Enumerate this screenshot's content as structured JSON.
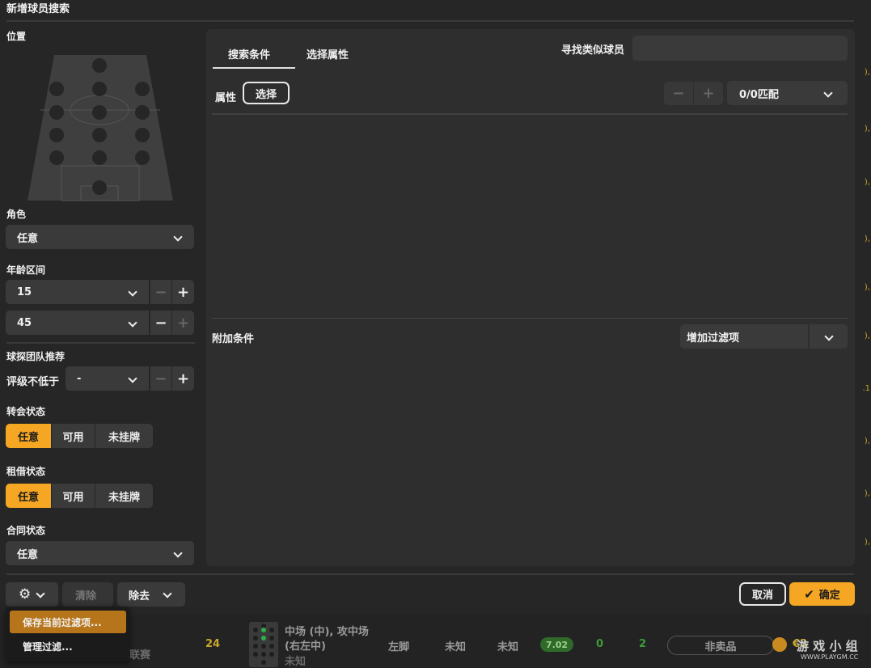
{
  "dialog": {
    "title": "新增球员搜索"
  },
  "position": {
    "label": "位置"
  },
  "role": {
    "label": "角色",
    "value": "任意"
  },
  "age": {
    "label": "年龄区间",
    "min": "15",
    "max": "45"
  },
  "scout": {
    "label": "球探团队推荐",
    "rating_label": "评级不低于",
    "rating_value": "-"
  },
  "transfer": {
    "label": "转会状态",
    "options": [
      "任意",
      "可用",
      "未挂牌"
    ]
  },
  "loan": {
    "label": "租借状态",
    "options": [
      "任意",
      "可用",
      "未挂牌"
    ]
  },
  "contract": {
    "label": "合同状态",
    "value": "任意"
  },
  "tabs": [
    "搜索条件",
    "选择属性"
  ],
  "similar": {
    "label": "寻找类似球员",
    "placeholder": ""
  },
  "attributes": {
    "label": "属性",
    "select_button": "选择",
    "match": "0/0匹配"
  },
  "extra": {
    "label": "附加条件",
    "add_filter": "增加过滤项"
  },
  "footer": {
    "clear": "清除",
    "remove": "除去",
    "cancel": "取消",
    "confirm": "确定"
  },
  "popup": {
    "save": "保存当前过滤项...",
    "manage": "管理过滤..."
  },
  "bottom_row": {
    "league": "联赛",
    "age": "24",
    "position_line1": "中场 (中), 攻中场",
    "position_line2": "(右左中)",
    "unknown_a": "未知",
    "foot": "左脚",
    "unknown_b": "未知",
    "unknown_c": "未知",
    "rating": "7.02",
    "stat_a": "0",
    "stat_b": "2",
    "sale": "非卖品",
    "value_prefix": "€3"
  },
  "watermark": {
    "text": "游 戏 小 组",
    "url": "WWW.PLAYGM.CC"
  },
  "colors": {
    "accent": "#f5a623",
    "bg": "#262626",
    "panel": "#2e2e2e",
    "control": "#3a3a3a"
  }
}
